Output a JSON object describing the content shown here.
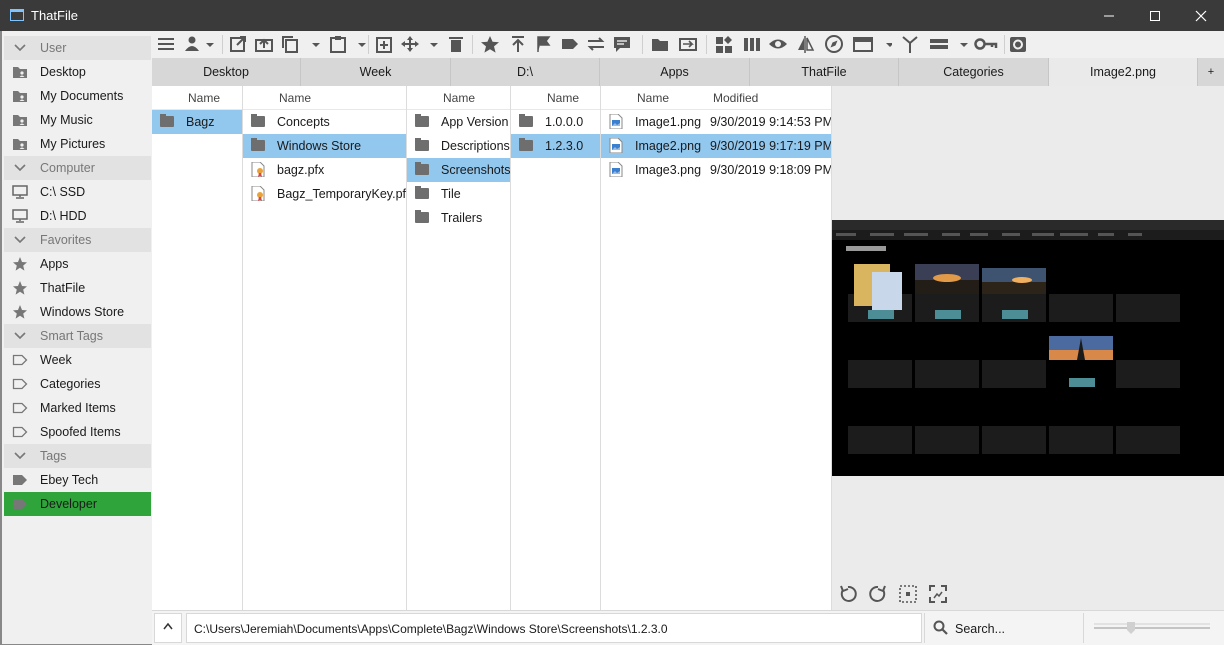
{
  "app": {
    "title": "ThatFile"
  },
  "sidebar": {
    "items": [
      {
        "label": "User",
        "type": "group"
      },
      {
        "label": "Desktop",
        "type": "item",
        "icon": "folder-user-icon"
      },
      {
        "label": "My Documents",
        "type": "item",
        "icon": "folder-user-icon"
      },
      {
        "label": "My Music",
        "type": "item",
        "icon": "folder-user-icon"
      },
      {
        "label": "My Pictures",
        "type": "item",
        "icon": "folder-user-icon"
      },
      {
        "label": "Computer",
        "type": "group"
      },
      {
        "label": "C:\\ SSD",
        "type": "item",
        "icon": "monitor-icon"
      },
      {
        "label": "D:\\ HDD",
        "type": "item",
        "icon": "monitor-icon"
      },
      {
        "label": "Favorites",
        "type": "group"
      },
      {
        "label": "Apps",
        "type": "item",
        "icon": "star-icon"
      },
      {
        "label": "ThatFile",
        "type": "item",
        "icon": "star-icon"
      },
      {
        "label": "Windows Store",
        "type": "item",
        "icon": "star-icon"
      },
      {
        "label": "Smart Tags",
        "type": "group"
      },
      {
        "label": "Week",
        "type": "item",
        "icon": "tag-outline-icon"
      },
      {
        "label": "Categories",
        "type": "item",
        "icon": "tag-outline-icon"
      },
      {
        "label": "Marked Items",
        "type": "item",
        "icon": "tag-outline-icon"
      },
      {
        "label": "Spoofed Items",
        "type": "item",
        "icon": "tag-outline-icon"
      },
      {
        "label": "Tags",
        "type": "group"
      },
      {
        "label": "Ebey Tech",
        "type": "item",
        "icon": "tag-icon"
      },
      {
        "label": "Developer",
        "type": "item",
        "icon": "tag-icon",
        "active": true
      }
    ]
  },
  "tabs": [
    {
      "label": "Desktop"
    },
    {
      "label": "Week"
    },
    {
      "label": "D:\\"
    },
    {
      "label": "Apps"
    },
    {
      "label": "ThatFile"
    },
    {
      "label": "Categories"
    },
    {
      "label": "Image2.png",
      "active": true
    }
  ],
  "tab_add_label": "+",
  "columns": [
    {
      "header": "Name",
      "rows": [
        {
          "name": "Bagz",
          "icon": "folder",
          "selected": true
        }
      ]
    },
    {
      "header": "Name",
      "rows": [
        {
          "name": "Concepts",
          "icon": "folder"
        },
        {
          "name": "Windows Store",
          "icon": "folder",
          "selected": true
        },
        {
          "name": "bagz.pfx",
          "icon": "certificate"
        },
        {
          "name": "Bagz_TemporaryKey.pfx",
          "icon": "certificate"
        }
      ]
    },
    {
      "header": "Name",
      "rows": [
        {
          "name": "App Version",
          "icon": "folder"
        },
        {
          "name": "Descriptions",
          "icon": "folder"
        },
        {
          "name": "Screenshots",
          "icon": "folder",
          "selected": true
        },
        {
          "name": "Tile",
          "icon": "folder"
        },
        {
          "name": "Trailers",
          "icon": "folder"
        }
      ]
    },
    {
      "header": "Name",
      "rows": [
        {
          "name": "1.0.0.0",
          "icon": "folder"
        },
        {
          "name": "1.2.3.0",
          "icon": "folder",
          "selected": true
        }
      ]
    },
    {
      "header": "Name",
      "header2": "Modified",
      "rows": [
        {
          "name": "Image1.png",
          "modified": "9/30/2019 9:14:53 PM",
          "icon": "image"
        },
        {
          "name": "Image2.png",
          "modified": "9/30/2019 9:17:19 PM",
          "icon": "image",
          "selected": true
        },
        {
          "name": "Image3.png",
          "modified": "9/30/2019 9:18:09 PM",
          "icon": "image"
        }
      ]
    }
  ],
  "statusbar": {
    "up_label": "^",
    "path": "C:\\Users\\Jeremiah\\Documents\\Apps\\Complete\\Bagz\\Windows Store\\Screenshots\\1.2.3.0",
    "search_placeholder": "Search..."
  },
  "colors": {
    "accent_selection": "#92c7ee",
    "active_tag": "#2ea43b",
    "titlebar": "#3a3a3a"
  }
}
